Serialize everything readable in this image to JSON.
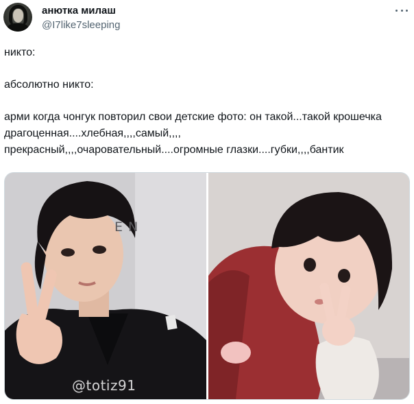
{
  "tweet": {
    "display_name": "анютка милаш",
    "handle": "@I7like7sleeping",
    "more_icon": "more-horizontal-icon"
  },
  "body": {
    "line1": "никто:",
    "line2": "абсолютно никто:",
    "line3": "арми когда чонгук повторил свои детские фото: он такой...такой крошечка драгоценная....хлебная,,,,самый,,,,\nпрекрасный,,,,очаровательный....огромные глазки....губки,,,,бантик"
  },
  "media": {
    "left_photo": {
      "watermark": "@totiz91",
      "background_text": "EN"
    },
    "right_photo": {}
  }
}
